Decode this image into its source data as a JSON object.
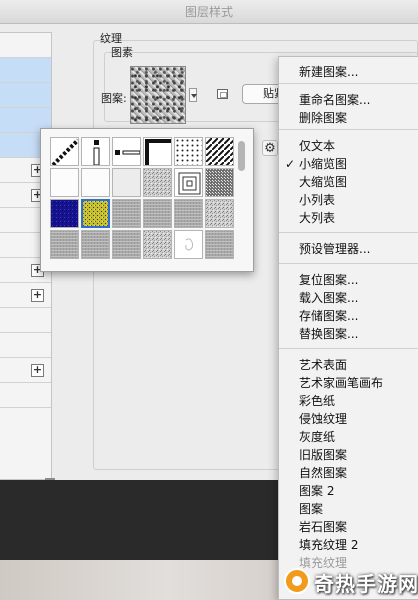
{
  "window": {
    "title": "图层样式"
  },
  "texture": {
    "group_label": "纹理",
    "sub_label": "图素",
    "pattern_label": "图案:",
    "snap_button_label": "贴紧原点"
  },
  "picker": {
    "thumbs": [
      "diagonal-stripe",
      "vertical-dots",
      "dash-dot",
      "corner-line",
      "polka-dots",
      "checker-diagonal",
      "white",
      "white",
      "light-gray",
      "fine-noise",
      "concentric-squares",
      "dense-noise",
      "blue-pattern",
      "yellow-pattern",
      "gray-weave",
      "gray-weave",
      "gray-weave",
      "gray-noise",
      "gray-weave",
      "gray-weave",
      "gray-weave",
      "gray-noise",
      "paper-white",
      "gray-weave"
    ]
  },
  "menu": {
    "items": [
      "新建图案...",
      "重命名图案...",
      "删除图案",
      "仅文本",
      "小缩览图",
      "大缩览图",
      "小列表",
      "大列表",
      "预设管理器...",
      "复位图案...",
      "载入图案...",
      "存储图案...",
      "替换图案...",
      "艺术表面",
      "艺术家画笔画布",
      "彩色纸",
      "侵蚀纹理",
      "灰度纸",
      "旧版图案",
      "自然图案",
      "图案 2",
      "图案",
      "岩石图案",
      "填充纹理 2",
      "填充纹理"
    ],
    "checked_index": 4,
    "check_mark": "✓"
  },
  "watermark": {
    "text": "奇热手游网"
  },
  "colors": {
    "selection": "#c6ddf7",
    "accent_orange": "#f29a1b",
    "dark_bar": "#2a2a2a"
  }
}
